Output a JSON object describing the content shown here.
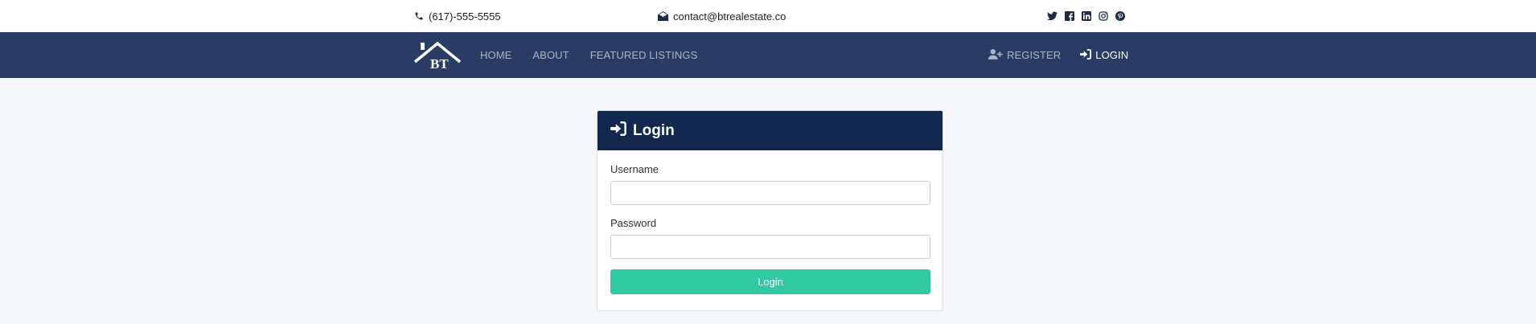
{
  "topbar": {
    "phone": "(617)-555-5555",
    "email": "contact@btrealestate.co",
    "social_icons": [
      "twitter-icon",
      "facebook-icon",
      "linkedin-icon",
      "instagram-icon",
      "pinterest-icon"
    ]
  },
  "navbar": {
    "logo_text": "BT",
    "links": {
      "home": "HOME",
      "about": "ABOUT",
      "featured": "FEATURED LISTINGS"
    },
    "register": "REGISTER",
    "login": "LOGIN"
  },
  "login_card": {
    "title": "Login",
    "username_label": "Username",
    "password_label": "Password",
    "username_value": "",
    "password_value": "",
    "submit_label": "Login"
  },
  "colors": {
    "navbar": "#2a3c63",
    "card_header": "#12284f",
    "button": "#31c9a2",
    "background": "#f6f7f9"
  }
}
